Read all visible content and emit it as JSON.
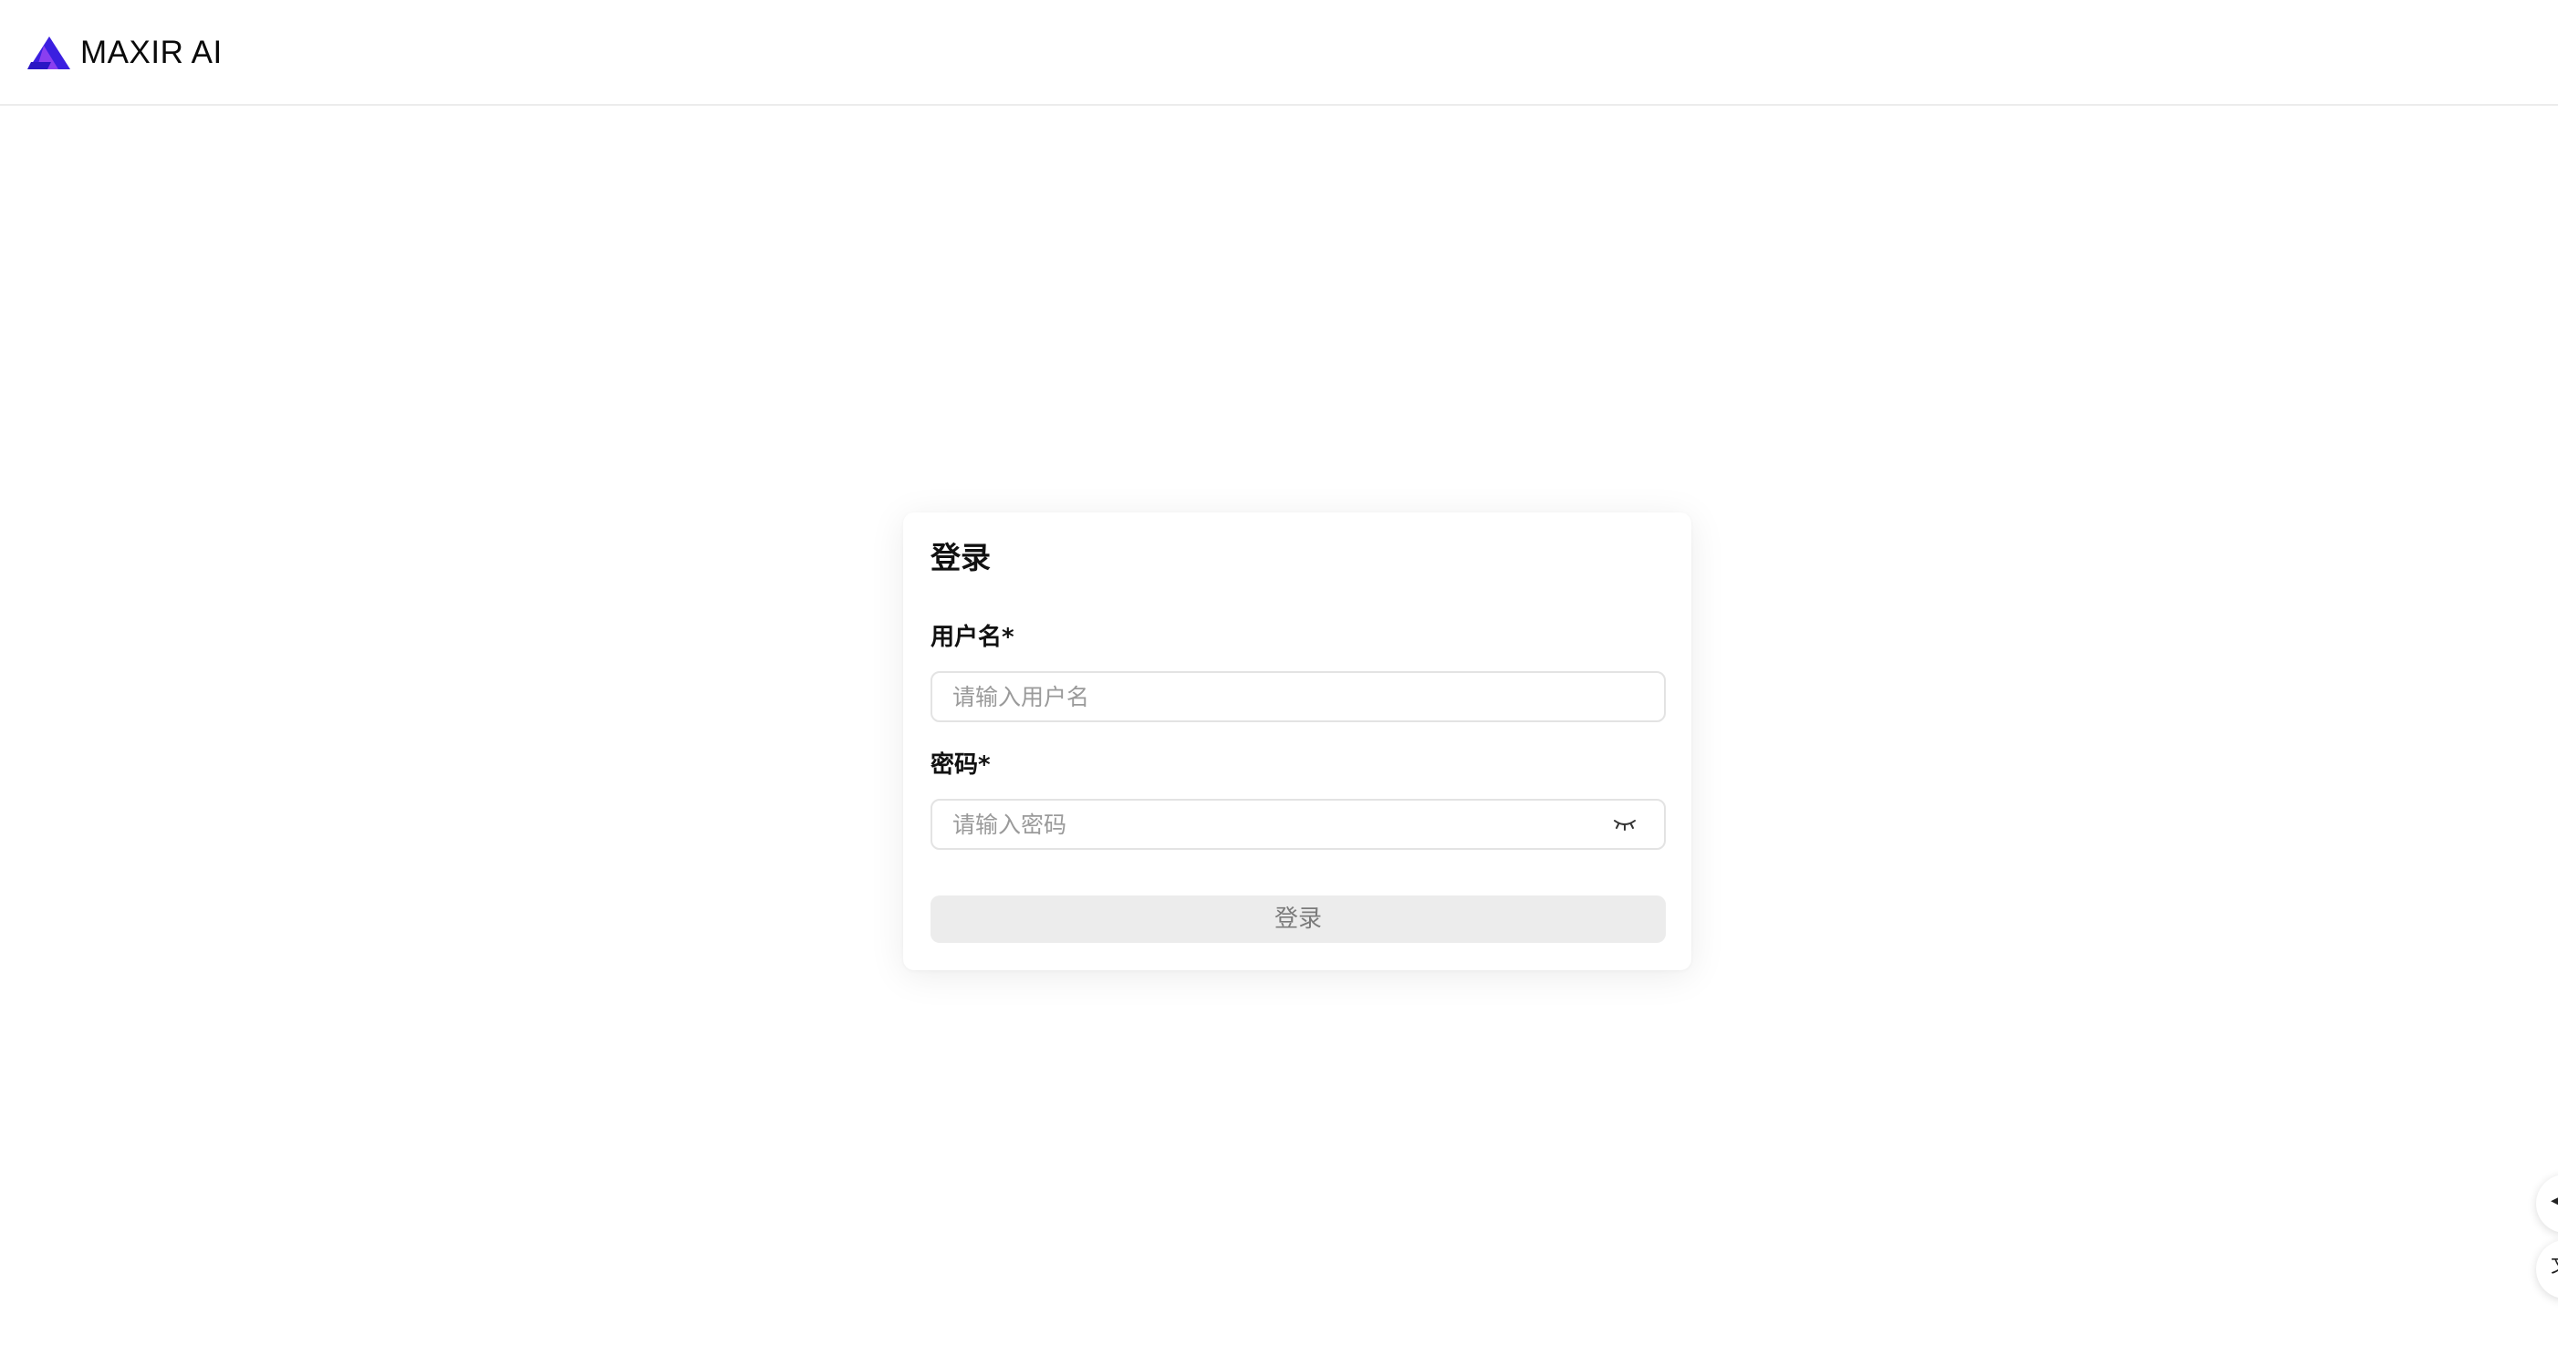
{
  "header": {
    "brand_name": "MAXIR AI",
    "logo_icon": "triangle-logo-icon",
    "brand_colors": [
      "#3b1fe0",
      "#8a3ff0"
    ]
  },
  "login": {
    "title": "登录",
    "username": {
      "label": "用户名*",
      "placeholder": "请输入用户名",
      "value": ""
    },
    "password": {
      "label": "密码*",
      "placeholder": "请输入密码",
      "value": "",
      "toggle_icon": "eye-closed-icon"
    },
    "submit_label": "登录",
    "submit_disabled": true
  },
  "floating_buttons": [
    {
      "icon": "arrow-left-icon"
    },
    {
      "icon": "translate-icon"
    }
  ]
}
